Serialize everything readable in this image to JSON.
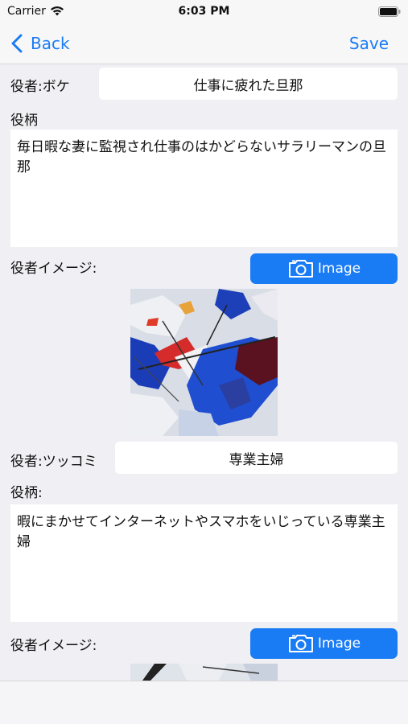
{
  "status_bar": {
    "carrier": "Carrier",
    "time": "6:03 PM"
  },
  "nav": {
    "back_label": "Back",
    "save_label": "Save"
  },
  "boke": {
    "actor_label": "役者:ボケ",
    "actor_value": "仕事に疲れた旦那",
    "role_label": "役柄",
    "role_text": "毎日暇な妻に監視され仕事のはかどらないサラリーマンの旦那",
    "image_label": "役者イメージ:",
    "image_button_label": "Image"
  },
  "tsukkomi": {
    "actor_label": "役者:ツッコミ",
    "actor_value": "専業主婦",
    "role_label": "役柄:",
    "role_text": "暇にまかせてインターネットやスマホをいじっている専業主婦",
    "image_label": "役者イメージ:",
    "image_button_label": "Image"
  },
  "colors": {
    "accent": "#1a7cf5",
    "background": "#efeff4",
    "field": "#ffffff"
  },
  "icons": [
    "back-chevron-icon",
    "wifi-icon",
    "battery-icon",
    "camera-icon"
  ]
}
